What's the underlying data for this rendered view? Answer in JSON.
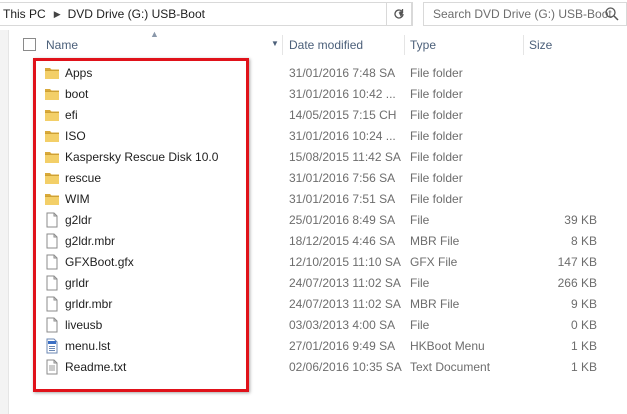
{
  "address": {
    "crumbs": [
      "This PC",
      "DVD Drive (G:) USB-Boot"
    ],
    "refresh_icon": "refresh-icon"
  },
  "search": {
    "placeholder": "Search DVD Drive (G:) USB-Boot"
  },
  "columns": {
    "name": "Name",
    "date": "Date modified",
    "type": "Type",
    "size": "Size"
  },
  "files": [
    {
      "name": "Apps",
      "date": "31/01/2016 7:48 SA",
      "type": "File folder",
      "size": "",
      "icon": "folder-icon"
    },
    {
      "name": "boot",
      "date": "31/01/2016 10:42 ...",
      "type": "File folder",
      "size": "",
      "icon": "folder-icon"
    },
    {
      "name": "efi",
      "date": "14/05/2015 7:15 CH",
      "type": "File folder",
      "size": "",
      "icon": "folder-icon"
    },
    {
      "name": "ISO",
      "date": "31/01/2016 10:24 ...",
      "type": "File folder",
      "size": "",
      "icon": "folder-icon"
    },
    {
      "name": "Kaspersky Rescue Disk 10.0",
      "date": "15/08/2015 11:42 SA",
      "type": "File folder",
      "size": "",
      "icon": "folder-icon"
    },
    {
      "name": "rescue",
      "date": "31/01/2016 7:56 SA",
      "type": "File folder",
      "size": "",
      "icon": "folder-icon"
    },
    {
      "name": "WIM",
      "date": "31/01/2016 7:51 SA",
      "type": "File folder",
      "size": "",
      "icon": "folder-icon"
    },
    {
      "name": "g2ldr",
      "date": "25/01/2016 8:49 SA",
      "type": "File",
      "size": "39 KB",
      "icon": "file-icon"
    },
    {
      "name": "g2ldr.mbr",
      "date": "18/12/2015 4:46 SA",
      "type": "MBR File",
      "size": "8 KB",
      "icon": "file-icon"
    },
    {
      "name": "GFXBoot.gfx",
      "date": "12/10/2015 11:10 SA",
      "type": "GFX File",
      "size": "147 KB",
      "icon": "file-icon"
    },
    {
      "name": "grldr",
      "date": "24/07/2013 11:02 SA",
      "type": "File",
      "size": "266 KB",
      "icon": "file-icon"
    },
    {
      "name": "grldr.mbr",
      "date": "24/07/2013 11:02 SA",
      "type": "MBR File",
      "size": "9 KB",
      "icon": "file-icon"
    },
    {
      "name": "liveusb",
      "date": "03/03/2013 4:00 SA",
      "type": "File",
      "size": "0 KB",
      "icon": "file-icon"
    },
    {
      "name": "menu.lst",
      "date": "27/01/2016 9:49 SA",
      "type": "HKBoot Menu",
      "size": "1 KB",
      "icon": "menu-file-icon"
    },
    {
      "name": "Readme.txt",
      "date": "02/06/2016 10:35 SA",
      "type": "Text Document",
      "size": "1 KB",
      "icon": "text-file-icon"
    }
  ],
  "colors": {
    "highlight": "#e0121a",
    "folder": "#e8c25a",
    "header_text": "#4c607a"
  }
}
